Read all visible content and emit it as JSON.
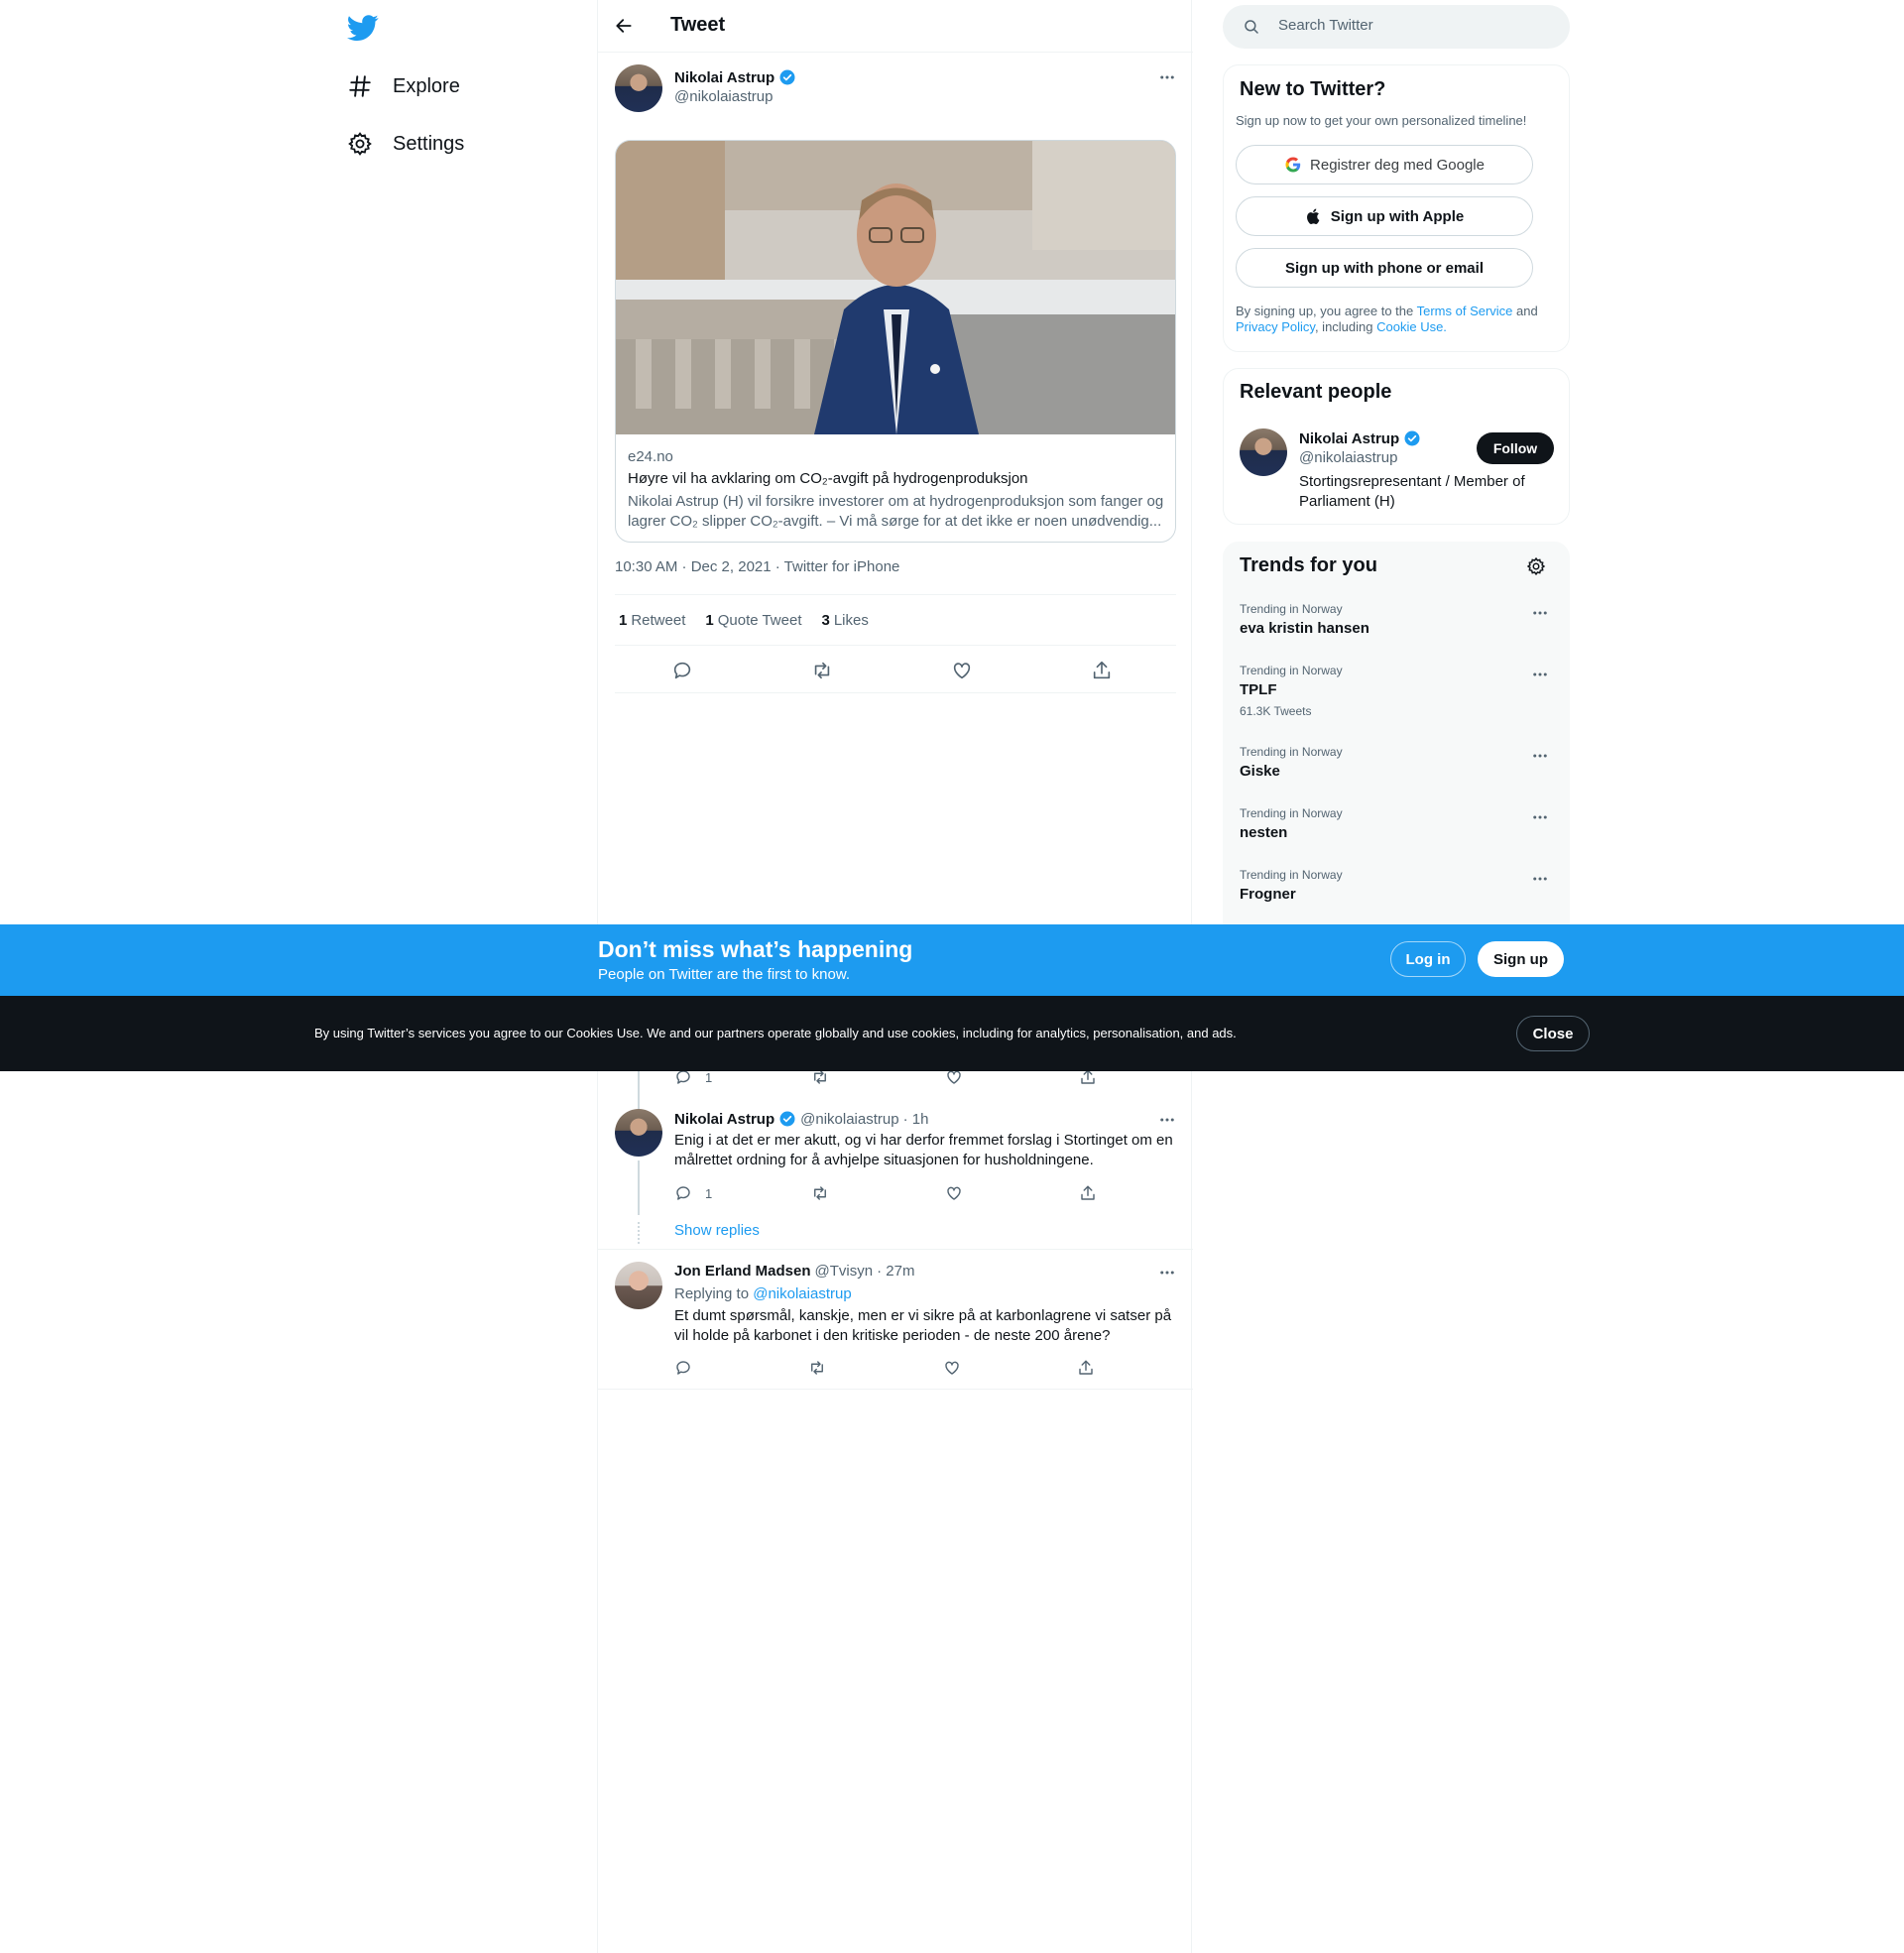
{
  "nav": {
    "explore_label": "Explore",
    "settings_label": "Settings"
  },
  "header": {
    "title": "Tweet"
  },
  "tweet": {
    "author_name": "Nikolai Astrup",
    "author_handle": "@nikolaiastrup",
    "card": {
      "domain": "e24.no",
      "title": "Høyre vil ha avklaring om CO₂-avgift på hydrogenproduksjon",
      "description": "Nikolai Astrup (H) vil forsikre investorer om at hydrogenproduksjon som fanger og lagrer CO₂ slipper CO₂-avgift. – Vi må sørge for at det ikke er noen unødvendig..."
    },
    "timestamp": "10:30 AM · Dec 2, 2021 · Twitter for iPhone",
    "stats": {
      "retweets_count": "1",
      "retweets_label": "Retweet",
      "quotes_count": "1",
      "quotes_label": "Quote Tweet",
      "likes_count": "3",
      "likes_label": "Likes"
    }
  },
  "replies": [
    {
      "reply_count": "1"
    },
    {
      "name": "Nikolai Astrup",
      "handle": "@nikolaiastrup",
      "time": "· 1h",
      "text": "Enig i at det er mer akutt, og vi har derfor fremmet forslag i Stortinget om en målrettet ordning for å avhjelpe situasjonen for husholdningene.",
      "reply_count": "1"
    },
    {
      "name": "Jon Erland Madsen",
      "handle": "@Tvisyn",
      "time": "· 27m",
      "replying_prefix": "Replying to",
      "replying_handle": "@nikolaiastrup",
      "text": "Et dumt spørsmål, kanskje, men er vi sikre på at karbonlagrene vi satser på vil holde på karbonet i den kritiske perioden - de neste 200 årene?"
    }
  ],
  "show_replies_label": "Show replies",
  "search": {
    "placeholder": "Search Twitter"
  },
  "new_to_twitter": {
    "title": "New to Twitter?",
    "subtitle": "Sign up now to get your own personalized timeline!",
    "google_label": "Registrer deg med Google",
    "apple_label": "Sign up with Apple",
    "phone_label": "Sign up with phone or email",
    "legal_1": "By signing up, you agree to the ",
    "terms": "Terms of Service",
    "legal_2": " and ",
    "privacy": "Privacy Policy",
    "legal_3": ", including ",
    "cookie": "Cookie Use."
  },
  "relevant_people": {
    "title": "Relevant people",
    "name": "Nikolai Astrup",
    "handle": "@nikolaiastrup",
    "bio": "Stortingsrepresentant / Member of Parliament (H)",
    "follow_label": "Follow"
  },
  "trends": {
    "title": "Trends for you",
    "items": [
      {
        "context": "Trending in Norway",
        "name": "eva kristin hansen",
        "count": ""
      },
      {
        "context": "Trending in Norway",
        "name": "TPLF",
        "count": "61.3K Tweets"
      },
      {
        "context": "Trending in Norway",
        "name": "Giske",
        "count": ""
      },
      {
        "context": "Trending in Norway",
        "name": "nesten",
        "count": ""
      },
      {
        "context": "Trending in Norway",
        "name": "Frogner",
        "count": ""
      }
    ]
  },
  "login_banner": {
    "title": "Don’t miss what’s happening",
    "subtitle": "People on Twitter are the first to know.",
    "login_label": "Log in",
    "signup_label": "Sign up"
  },
  "cookie_banner": {
    "text": "By using Twitter’s services you agree to our Cookies Use. We and our partners operate globally and use cookies, including for analytics, personalisation, and ads.",
    "close_label": "Close"
  },
  "colors": {
    "accent": "#1d9bf0",
    "text": "#0f1419",
    "secondary_text": "#536471",
    "cookie_bar": "#0f1419"
  },
  "icons": [
    "twitter-logo-icon",
    "hashtag-icon",
    "gear-icon",
    "back-arrow-icon",
    "verified-badge-icon",
    "more-icon",
    "reply-icon",
    "retweet-icon",
    "like-icon",
    "share-icon",
    "search-icon",
    "google-icon",
    "apple-icon"
  ]
}
